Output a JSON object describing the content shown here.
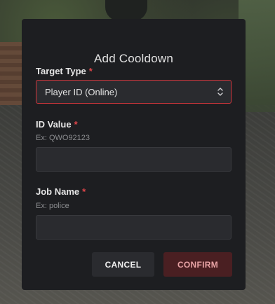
{
  "modal": {
    "title": "Add Cooldown",
    "required_marker": "*"
  },
  "fields": {
    "target_type": {
      "label": "Target Type",
      "selected": "Player ID (Online)"
    },
    "id_value": {
      "label": "ID Value",
      "hint": "Ex: QWO92123",
      "value": ""
    },
    "job_name": {
      "label": "Job Name",
      "hint": "Ex: police",
      "value": ""
    }
  },
  "buttons": {
    "cancel": "CANCEL",
    "confirm": "CONFIRM"
  },
  "icons": {
    "select_chevron": "chevron-up-down-icon"
  },
  "colors": {
    "modal_bg": "#1d1e21",
    "required": "#e0464a",
    "select_border": "#d3363c",
    "confirm_bg": "#4a1f22",
    "confirm_text": "#e8a3a5"
  }
}
